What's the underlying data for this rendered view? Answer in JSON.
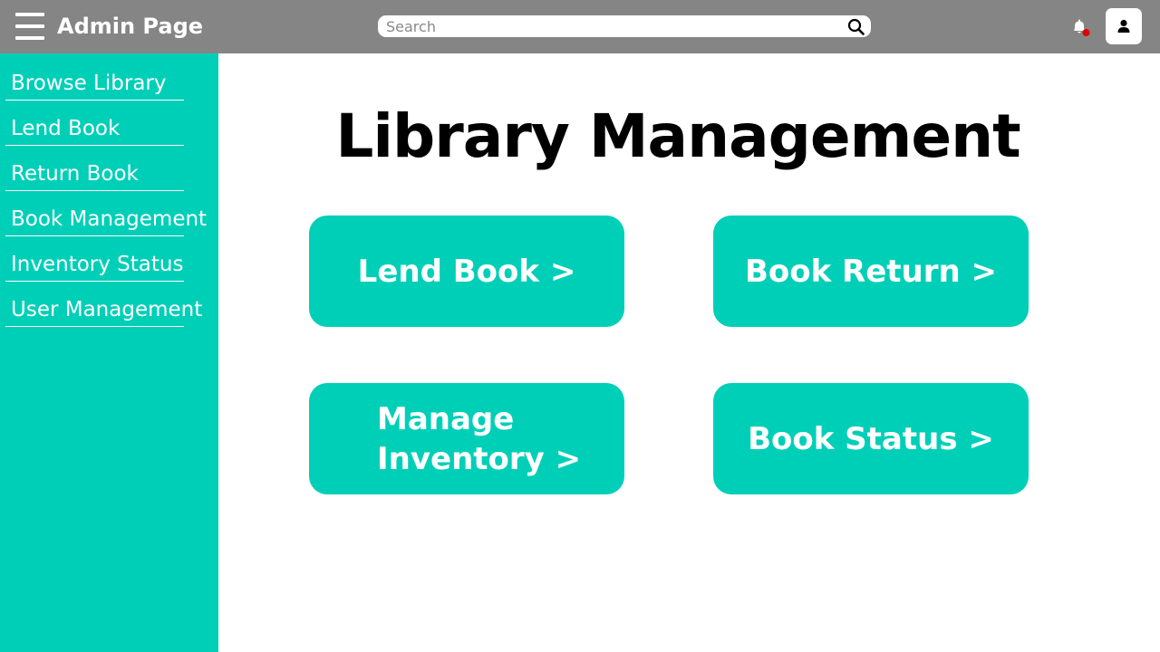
{
  "header": {
    "title": "Admin Page",
    "menu_icon": "hamburger-menu-icon",
    "search_placeholder": "Search",
    "search_value": "",
    "notification_icon": "bell-icon",
    "profile_icon": "user-icon"
  },
  "sidebar": {
    "items": [
      {
        "label": "Browse Library"
      },
      {
        "label": "Lend Book"
      },
      {
        "label": "Return Book"
      },
      {
        "label": "Book Management"
      },
      {
        "label": "Inventory Status"
      },
      {
        "label": "User Management"
      }
    ]
  },
  "main": {
    "title": "Library Management",
    "cards": [
      {
        "label": "Lend Book >"
      },
      {
        "label": "Book Return >"
      },
      {
        "label": "Manage Inventory >"
      },
      {
        "label": "Book Status >"
      }
    ]
  },
  "colors": {
    "topbar": "#858585",
    "accent": "#00cfb8",
    "notification_dot": "#e00000"
  }
}
